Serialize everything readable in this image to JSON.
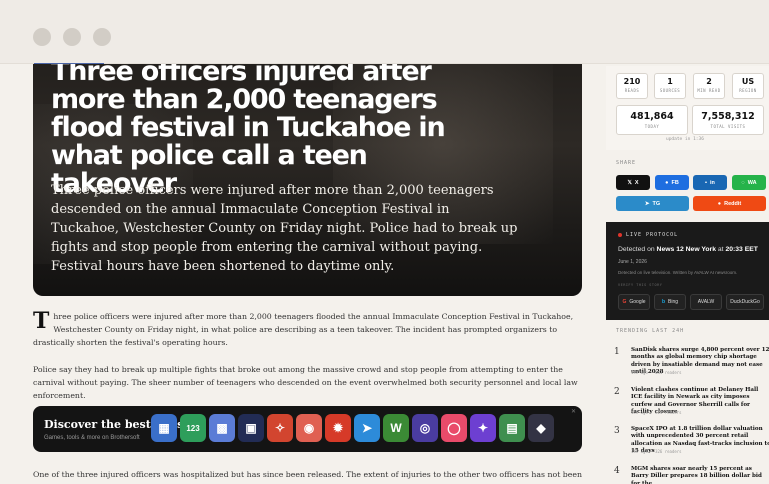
{
  "hero": {
    "title": "Three officers injured after more than 2,000 teenagers flood festival in Tuckahoe in what police call a teen takeover",
    "summary": "Three police officers were injured after more than 2,000 teenagers descended on the annual Immaculate Conception Festival in Tuckahoe, Westchester County on Friday night. Police had to break up fights and stop people from entering the carnival without paying. Festival hours have been shortened to daytime only."
  },
  "article": {
    "dropcap": "T",
    "p1": "hree police officers were injured after more than 2,000 teenagers flooded the annual Immaculate Conception Festival in Tuckahoe, Westchester County on Friday night, in what police are describing as a teen takeover. The incident has prompted organizers to drastically shorten the festival's operating hours.",
    "p2": "Police say they had to break up multiple fights that broke out among the massive crowd and stop people from attempting to enter the carnival without paying. The sheer number of teenagers who descended on the event overwhelmed both security personnel and local law enforcement.",
    "p3": "One of the three injured officers was hospitalized but has since been released. The extent of injuries to the other two officers has not been disclosed,"
  },
  "promo": {
    "title": "Discover the best apps",
    "subtitle": "Games, tools & more on Brothersoft",
    "close": "✕",
    "chevron": "›",
    "apps": [
      {
        "icon": "blue-shop-icon",
        "glyph": "▦",
        "color": "#3a6fc9"
      },
      {
        "icon": "number-puzzle-icon",
        "glyph": "123",
        "color": "#2e9e5b"
      },
      {
        "icon": "grid-game-icon",
        "glyph": "▩",
        "color": "#5b7cd6"
      },
      {
        "icon": "photo-frame-icon",
        "glyph": "▣",
        "color": "#222c55"
      },
      {
        "icon": "compass-icon",
        "glyph": "✧",
        "color": "#d2452f"
      },
      {
        "icon": "fingerprint-icon",
        "glyph": "◉",
        "color": "#e06052"
      },
      {
        "icon": "flame-game-icon",
        "glyph": "✹",
        "color": "#d63a28"
      },
      {
        "icon": "arrow-icon",
        "glyph": "➤",
        "color": "#2d8bd9"
      },
      {
        "icon": "letters-icon",
        "glyph": "W",
        "color": "#3b8a35"
      },
      {
        "icon": "lens-icon",
        "glyph": "◎",
        "color": "#4a3ca0"
      },
      {
        "icon": "donut-icon",
        "glyph": "◯",
        "color": "#e94b6a"
      },
      {
        "icon": "star-app-icon",
        "glyph": "✦",
        "color": "#6d3fd1"
      },
      {
        "icon": "notes-icon",
        "glyph": "▤",
        "color": "#3f8f4f"
      },
      {
        "icon": "faded-app-icon",
        "glyph": "◆",
        "color": "#334"
      }
    ]
  },
  "stats": {
    "reads": {
      "value": "210",
      "label": "READS"
    },
    "sources": {
      "value": "1",
      "label": "SOURCES"
    },
    "min_read": {
      "value": "2",
      "label": "MIN READ"
    },
    "region": {
      "value": "US",
      "label": "REGION"
    },
    "today": {
      "value": "481,864",
      "label": "TODAY"
    },
    "total": {
      "value": "7,558,312",
      "label": "TOTAL VISITS"
    },
    "updated": "update in 1:36"
  },
  "share": {
    "label": "SHARE",
    "x": "X",
    "fb": "FB",
    "in": "in",
    "wa": "WA",
    "tg": "TG",
    "reddit": "Reddit"
  },
  "live": {
    "badge": "LIVE PROTOCOL",
    "detected_prefix": "Detected on ",
    "source": "News 12 New York",
    "at": " at ",
    "time": "20:33 EET",
    "date": "June 1, 2026",
    "note": "Detected on live television. Written by AVALW AI newsroom.",
    "verify_label": "VERIFY THIS STORY",
    "buttons": [
      "Google",
      "Bing",
      "AVALW",
      "DuckDuckGo"
    ]
  },
  "trending": {
    "label": "TRENDING LAST 24H",
    "items": [
      {
        "num": "1",
        "title": "SanDisk shares surge 4,800 percent over 12 months as global memory chip shortage driven by insatiable demand may not ease until 2028",
        "meta": "19h ago · 641 readers"
      },
      {
        "num": "2",
        "title": "Violent clashes continue at Delaney Hall ICE facility in Newark as city imposes curfew and Governor Sherrill calls for facility closure",
        "meta": "15h ago · 524 readers"
      },
      {
        "num": "3",
        "title": "SpaceX IPO at 1.8 trillion dollar valuation with unprecedented 30 percent retail allocation as Nasdaq fast-tracks inclusion to 15 days",
        "meta": "14h ago · 326 readers"
      },
      {
        "num": "4",
        "title": "MGM shares soar nearly 15 percent as Barry Diller prepares 18 billion dollar bid for the",
        "meta": ""
      }
    ]
  },
  "colors": {
    "x": "#111111",
    "fb": "#1e6ee0",
    "in": "#1967b3",
    "wa": "#25b34a",
    "tg": "#2b8bc9",
    "reddit": "#ef4a14",
    "live_dot": "#e0342b"
  }
}
